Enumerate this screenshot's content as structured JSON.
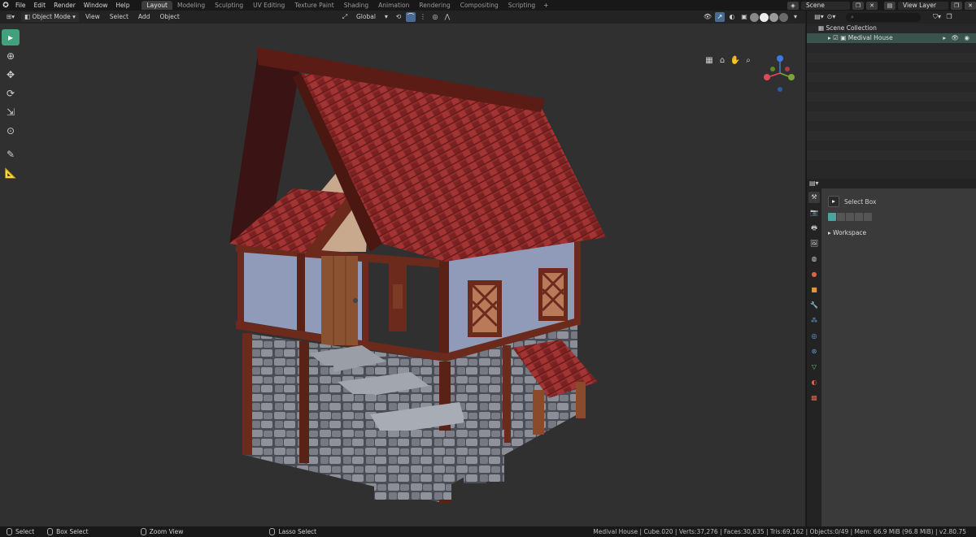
{
  "menu": {
    "items": [
      "File",
      "Edit",
      "Render",
      "Window",
      "Help"
    ]
  },
  "workspaces": {
    "tabs": [
      "Layout",
      "Modeling",
      "Sculpting",
      "UV Editing",
      "Texture Paint",
      "Shading",
      "Animation",
      "Rendering",
      "Compositing",
      "Scripting"
    ],
    "active": "Layout",
    "add_label": "+"
  },
  "scene": {
    "name": "Scene",
    "view_layer": "View Layer"
  },
  "viewport_header": {
    "mode": "Object Mode",
    "menus": [
      "View",
      "Select",
      "Add",
      "Object"
    ],
    "transform_orientation": "Global"
  },
  "outliner": {
    "collection": "Scene Collection",
    "object": "Medival House",
    "search_placeholder": "⌕"
  },
  "properties": {
    "active_tool": "Select Box",
    "panel": "Workspace"
  },
  "status": {
    "select": "Select",
    "box_select": "Box Select",
    "zoom_view": "Zoom View",
    "lasso_select": "Lasso Select",
    "stats": "Medival House | Cube.020 | Verts:37,276 | Faces:30,635 | Tris:69,162 | Objects:0/49 | Mem: 66.9 MiB (96.8 MiB) | v2.80.75"
  },
  "colors": {
    "accent": "#43a07c",
    "selected_row": "#39544c",
    "roof": "#8e2a2a",
    "timber": "#6b2a1c",
    "plaster": "#8f9bb8",
    "stone": "#7d8088"
  },
  "icons": [
    "blender-logo-icon",
    "cursor-icon",
    "move-icon",
    "rotate-icon",
    "scale-icon",
    "transform-icon",
    "annotate-icon",
    "measure-icon",
    "hand-icon",
    "zoom-icon",
    "camera-icon",
    "grid-icon",
    "eye-icon"
  ]
}
